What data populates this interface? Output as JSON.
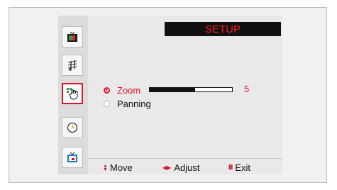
{
  "title": "SETUP",
  "side_menu": [
    {
      "icon": "picture-tv-icon",
      "active": false
    },
    {
      "icon": "sound-music-icon",
      "active": false
    },
    {
      "icon": "setup-hand-icon",
      "active": true
    },
    {
      "icon": "clock-timer-icon",
      "active": false
    },
    {
      "icon": "input-source-icon",
      "active": false
    }
  ],
  "options": {
    "zoom": {
      "label": "Zoom",
      "value": "5",
      "level_fraction": 0.55
    },
    "panning": {
      "label": "Panning"
    }
  },
  "footer": {
    "move_glyph": "▲▼",
    "move": "Move",
    "adjust_glyph": "◀▶",
    "adjust": "Adjust",
    "exit_glyph": "III",
    "exit": "Exit"
  },
  "colors": {
    "accent": "#e0112a",
    "title_bg": "#111111"
  }
}
